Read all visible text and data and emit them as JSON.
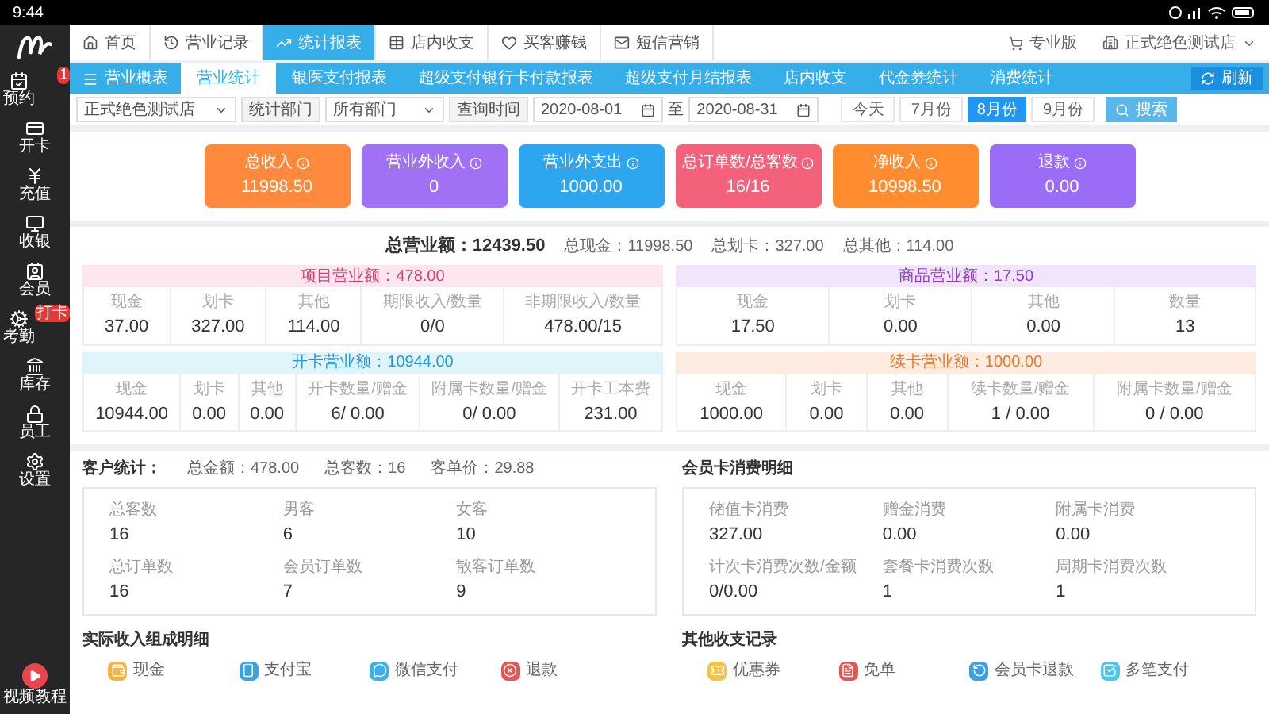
{
  "status_bar": {
    "time": "9:44"
  },
  "sidebar": {
    "items": [
      {
        "label": "预约",
        "badge": "1"
      },
      {
        "label": "开卡"
      },
      {
        "label": "充值"
      },
      {
        "label": "收银"
      },
      {
        "label": "会员"
      },
      {
        "label": "考勤",
        "badge": "打卡"
      },
      {
        "label": "库存"
      },
      {
        "label": "员工"
      },
      {
        "label": "设置"
      }
    ],
    "video": {
      "label": "视频教程"
    }
  },
  "top_tabs": [
    {
      "label": "首页",
      "selected": false
    },
    {
      "label": "营业记录",
      "selected": false
    },
    {
      "label": "统计报表",
      "selected": true
    },
    {
      "label": "店内收支",
      "selected": false
    },
    {
      "label": "买客赚钱",
      "selected": false
    },
    {
      "label": "短信营销",
      "selected": false
    }
  ],
  "top_right": {
    "edition": "专业版",
    "store": "正式绝色测试店"
  },
  "sub_tabs": {
    "menu": "营业概表",
    "tabs": [
      {
        "label": "营业统计",
        "selected": true
      },
      {
        "label": "银医支付报表",
        "selected": false
      },
      {
        "label": "超级支付银行卡付款报表",
        "selected": false
      },
      {
        "label": "超级支付月结报表",
        "selected": false
      },
      {
        "label": "店内收支",
        "selected": false
      },
      {
        "label": "代金券统计",
        "selected": false
      },
      {
        "label": "消费统计",
        "selected": false
      }
    ],
    "refresh": "刷新"
  },
  "filters": {
    "store": "正式绝色测试店",
    "dept_label": "统计部门",
    "dept": "所有部门",
    "time_label": "查询时间",
    "from": "2020-08-01",
    "to_label": "至",
    "to": "2020-08-31",
    "quick": [
      {
        "label": "今天",
        "selected": false
      },
      {
        "label": "7月份",
        "selected": false
      },
      {
        "label": "8月份",
        "selected": true
      },
      {
        "label": "9月份",
        "selected": false
      }
    ],
    "search": "搜索"
  },
  "cards": [
    {
      "label": "总收入",
      "value": "11998.50",
      "color": "#ff8a3d"
    },
    {
      "label": "营业外收入",
      "value": "0",
      "color": "#a070f5"
    },
    {
      "label": "营业外支出",
      "value": "1000.00",
      "color": "#2ea6ef"
    },
    {
      "label": "总订单数/总客数",
      "value": "16/16",
      "color": "#f3627a"
    },
    {
      "label": "净收入",
      "value": "10998.50",
      "color": "#ff8c2e"
    },
    {
      "label": "退款",
      "value": "0.00",
      "color": "#9b6cf6"
    }
  ],
  "summary": {
    "total": "总营业额：12439.50",
    "parts": [
      "总现金：11998.50",
      "总划卡：327.00",
      "总其他：114.00"
    ],
    "blocks": [
      {
        "kind": "pink",
        "title": "项目营业额：478.00",
        "cells": [
          {
            "label": "现金",
            "value": "37.00"
          },
          {
            "label": "划卡",
            "value": "327.00"
          },
          {
            "label": "其他",
            "value": "114.00"
          },
          {
            "label": "期限收入/数量",
            "value": "0/0"
          },
          {
            "label": "非期限收入/数量",
            "value": "478.00/15"
          }
        ]
      },
      {
        "kind": "purple",
        "title": "商品营业额：17.50",
        "cells": [
          {
            "label": "现金",
            "value": "17.50"
          },
          {
            "label": "划卡",
            "value": "0.00"
          },
          {
            "label": "其他",
            "value": "0.00"
          },
          {
            "label": "数量",
            "value": "13"
          }
        ]
      },
      {
        "kind": "cyan",
        "title": "开卡营业额：10944.00",
        "cells": [
          {
            "label": "现金",
            "value": "10944.00"
          },
          {
            "label": "划卡",
            "value": "0.00"
          },
          {
            "label": "其他",
            "value": "0.00"
          },
          {
            "label": "开卡数量/赠金",
            "value": "6/ 0.00"
          },
          {
            "label": "附属卡数量/赠金",
            "value": "0/ 0.00"
          },
          {
            "label": "开卡工本费",
            "value": "231.00"
          }
        ]
      },
      {
        "kind": "orange",
        "title": "续卡营业额：1000.00",
        "cells": [
          {
            "label": "现金",
            "value": "1000.00"
          },
          {
            "label": "划卡",
            "value": "0.00"
          },
          {
            "label": "其他",
            "value": "0.00"
          },
          {
            "label": "续卡数量/赠金",
            "value": "1 / 0.00"
          },
          {
            "label": "附属卡数量/赠金",
            "value": "0 / 0.00"
          }
        ]
      }
    ]
  },
  "customer_stats": {
    "title": "客户统计：",
    "extras": [
      "总金额：478.00",
      "总客数：16",
      "客单价：29.88"
    ],
    "items": [
      {
        "label": "总客数",
        "value": "16"
      },
      {
        "label": "男客",
        "value": "6"
      },
      {
        "label": "女客",
        "value": "10"
      },
      {
        "label": "总订单数",
        "value": "16"
      },
      {
        "label": "会员订单数",
        "value": "7"
      },
      {
        "label": "散客订单数",
        "value": "9"
      }
    ]
  },
  "member_card": {
    "title": "会员卡消费明细",
    "items": [
      {
        "label": "储值卡消费",
        "value": "327.00"
      },
      {
        "label": "赠金消费",
        "value": "0.00"
      },
      {
        "label": "附属卡消费",
        "value": "0.00"
      },
      {
        "label": "计次卡消费次数/金额",
        "value": "0/0.00"
      },
      {
        "label": "套餐卡消费次数",
        "value": "1"
      },
      {
        "label": "周期卡消费次数",
        "value": "1"
      }
    ]
  },
  "income": {
    "title": "实际收入组成明细",
    "items": [
      {
        "label": "现金",
        "color": "#f5b342"
      },
      {
        "label": "支付宝",
        "color": "#3aa0e0"
      },
      {
        "label": "微信支付",
        "color": "#3bb0e6"
      },
      {
        "label": "退款",
        "color": "#e25656"
      }
    ]
  },
  "other": {
    "title": "其他收支记录",
    "items": [
      {
        "label": "优惠券",
        "color": "#f5c542"
      },
      {
        "label": "免单",
        "color": "#e25656"
      },
      {
        "label": "会员卡退款",
        "color": "#3aa0e0"
      },
      {
        "label": "多笔支付",
        "color": "#4fc3e8"
      }
    ]
  }
}
